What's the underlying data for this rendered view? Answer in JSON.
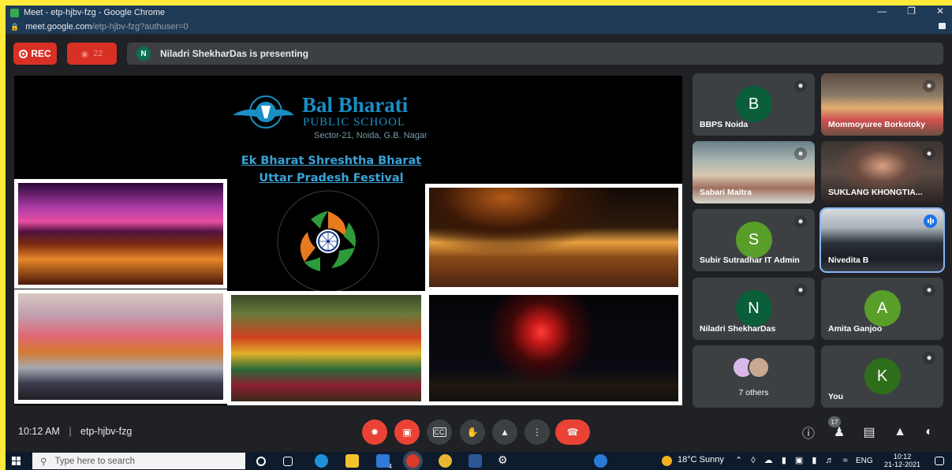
{
  "window": {
    "title": "Meet - etp-hjbv-fzg - Google Chrome",
    "url_host": "meet.google.com",
    "url_path": "/etp-hjbv-fzg?authuser=0"
  },
  "topbar": {
    "rec_label": "REC",
    "viewers_count": "22",
    "presenter_initial": "N",
    "presenting_text": "Niladri ShekharDas is presenting"
  },
  "slide": {
    "school_name": "Bal Bharati",
    "school_sub": "PUBLIC SCHOOL",
    "school_address": "Sector-21, Noida, G.B. Nagar",
    "title_line1": "Ek Bharat Shreshtha Bharat",
    "title_line2": "Uttar Pradesh Festival"
  },
  "participants": [
    {
      "name": "BBPS Noida",
      "initial": "B",
      "color": "#0b5e3a"
    },
    {
      "name": "Mommoyuree Borkotoky"
    },
    {
      "name": "Sabari Maitra"
    },
    {
      "name": "SUKLANG KHONGTIA..."
    },
    {
      "name": "Subir Sutradhar IT Admin",
      "initial": "S",
      "color": "#5a9e2a"
    },
    {
      "name": "Nivedita B"
    },
    {
      "name": "Niladri ShekharDas",
      "initial": "N",
      "color": "#0b5e3a"
    },
    {
      "name": "Amita Ganjoo",
      "initial": "A",
      "color": "#5a9e2a"
    },
    {
      "name": "7 others"
    },
    {
      "name": "You",
      "initial": "K",
      "color": "#2e6e1a"
    }
  ],
  "bottombar": {
    "time": "10:12 AM",
    "meeting_code": "etp-hjbv-fzg",
    "participant_count": "17"
  },
  "taskbar": {
    "search_placeholder": "Type here to search",
    "mail_badge": "4",
    "weather": "18°C  Sunny",
    "lang": "ENG",
    "clock_time": "10:12",
    "clock_date": "21-12-2021"
  }
}
